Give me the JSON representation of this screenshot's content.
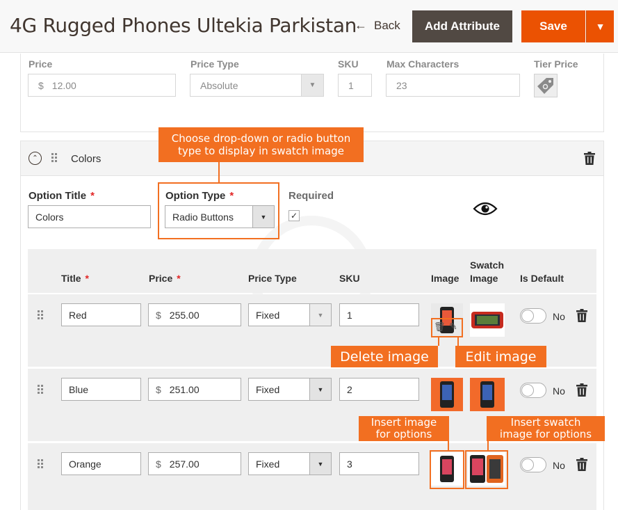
{
  "header": {
    "title": "4G Rugged Phones Ultekia Parkistan",
    "back_label": "Back",
    "add_attribute_label": "Add Attribute",
    "save_label": "Save"
  },
  "price_row": {
    "price_label": "Price",
    "price_currency": "$",
    "price_value": "12.00",
    "price_type_label": "Price Type",
    "price_type_value": "Absolute",
    "sku_label": "SKU",
    "sku_value": "1",
    "max_chars_label": "Max Characters",
    "max_chars_value": "23",
    "tier_price_label": "Tier Price"
  },
  "option_section": {
    "section_title": "Colors",
    "option_title_label": "Option Title",
    "option_title_value": "Colors",
    "option_type_label": "Option Type",
    "option_type_value": "Radio Buttons",
    "required_label": "Required",
    "required_checked": true
  },
  "grid": {
    "columns": {
      "title": "Title",
      "price": "Price",
      "price_type": "Price Type",
      "sku": "SKU",
      "image": "Image",
      "swatch_line1": "Swatch",
      "swatch_line2": "Image",
      "is_default": "Is Default"
    },
    "rows": [
      {
        "title": "Red",
        "currency": "$",
        "price": "255.00",
        "price_type": "Fixed",
        "sku": "1",
        "default_label": "No"
      },
      {
        "title": "Blue",
        "currency": "$",
        "price": "251.00",
        "price_type": "Fixed",
        "sku": "2",
        "default_label": "No"
      },
      {
        "title": "Orange",
        "currency": "$",
        "price": "257.00",
        "price_type": "Fixed",
        "sku": "3",
        "default_label": "No"
      }
    ]
  },
  "annotations": {
    "option_type_callout_line1": "Choose drop-down or radio button",
    "option_type_callout_line2": "type to display in swatch image",
    "delete_image": "Delete image",
    "edit_image": "Edit image",
    "insert_image_line1": "Insert image",
    "insert_image_line2": "for options",
    "insert_swatch_line1": "Insert swatch",
    "insert_swatch_line2": "image for options"
  },
  "colors": {
    "accent": "#eb5202",
    "annotation": "#f26f21",
    "dark_button": "#514943"
  },
  "icons": {
    "collapse": "collapse-circle-icon",
    "drag": "drag-handle-icon",
    "delete": "trash-icon",
    "visibility": "eye-icon",
    "tier_price": "price-tag-icon",
    "back": "arrow-left-icon",
    "dropdown": "chevron-down-icon"
  }
}
